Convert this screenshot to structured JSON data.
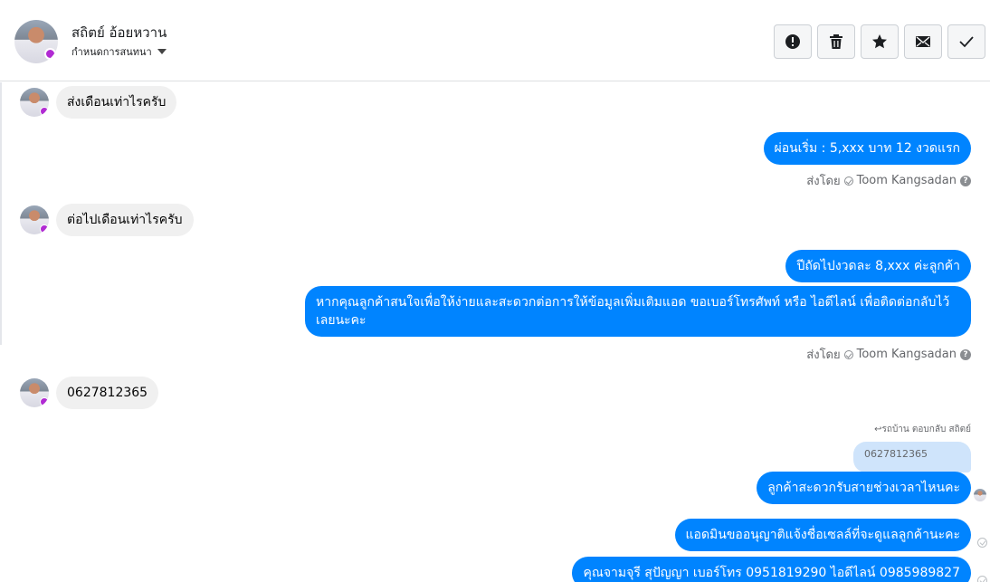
{
  "header": {
    "contact_name": "สถิตย์ อ้อยหวาน",
    "subtitle": "กำหนดการสนทนา",
    "tools": [
      {
        "name": "alert-icon"
      },
      {
        "name": "trash-icon"
      },
      {
        "name": "star-icon"
      },
      {
        "name": "envelope-icon"
      },
      {
        "name": "checkmark-icon"
      }
    ]
  },
  "messages": {
    "m1": "ส่งเดือนเท่าไรครับ",
    "m2": "ผ่อนเริ่ม : 5,xxx บาท 12 งวดแรก",
    "m2_sent_by": "ส่งโดย",
    "m2_sender": "Toom Kangsadan",
    "m3": "ต่อไปเดือนเท่าไรครับ",
    "m4": "ปีถัดไปงวดละ 8,xxx ค่ะลูกค้า",
    "m5": "หากคุณลูกค้าสนใจเพื่อให้ง่ายและสะดวกต่อการให้ข้อมูลเพิ่มเติมแอด ขอเบอร์โทรศัพท์ หรือ ไอดีไลน์ เพื่อติดต่อกลับไว้เลยนะคะ",
    "m5_sent_by": "ส่งโดย",
    "m5_sender": "Toom Kangsadan",
    "m6": "0627812365",
    "reply_note": "รถบ้าน ตอบกลับ สถิตย์",
    "quoted": "0627812365",
    "m7": "ลูกค้าสะดวกรับสายช่วงเวลาไหนคะ",
    "m8": "แอดมินขออนุญาติแจ้งชื่อเซลล์ที่จะดูแลลูกค้านะคะ",
    "m9": "คุณจามจุรี สุปัญญา เบอร์โทร 0951819290  ไอดีไลน์ 0985989827"
  },
  "colors": {
    "outgoing_bubble": "#0084ff",
    "incoming_bubble": "#f0f0f0",
    "quoted_bubble": "#cfe4fb"
  }
}
